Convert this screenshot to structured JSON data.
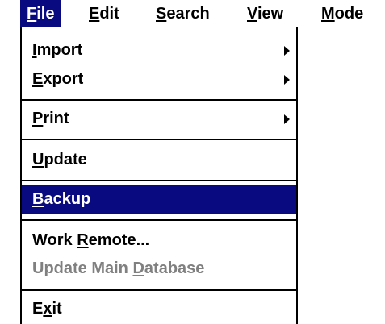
{
  "menubar": {
    "items": [
      {
        "pre": "",
        "acc": "F",
        "post": "ile",
        "active": true
      },
      {
        "pre": "",
        "acc": "E",
        "post": "dit",
        "active": false
      },
      {
        "pre": "",
        "acc": "S",
        "post": "earch",
        "active": false
      },
      {
        "pre": "",
        "acc": "V",
        "post": "iew",
        "active": false
      },
      {
        "pre": "",
        "acc": "M",
        "post": "ode",
        "active": false
      }
    ]
  },
  "file_menu": {
    "items": [
      {
        "pre": "",
        "acc": "I",
        "post": "mport",
        "submenu": true
      },
      {
        "pre": "",
        "acc": "E",
        "post": "xport",
        "submenu": true
      },
      {
        "pre": "",
        "acc": "P",
        "post": "rint",
        "submenu": true
      },
      {
        "pre": "",
        "acc": "U",
        "post": "pdate",
        "submenu": false
      },
      {
        "pre": "",
        "acc": "B",
        "post": "ackup",
        "submenu": false,
        "highlighted": true
      },
      {
        "pre": "Work ",
        "acc": "R",
        "post": "emote...",
        "submenu": false
      },
      {
        "pre": "Update Main ",
        "acc": "D",
        "post": "atabase",
        "submenu": false,
        "disabled": true
      },
      {
        "pre": "E",
        "acc": "x",
        "post": "it",
        "submenu": false
      }
    ]
  },
  "colors": {
    "highlight": "#0a0a80",
    "highlight_text": "#ffffff",
    "disabled_text": "#808080"
  },
  "icons": {
    "submenu_arrow": "chevron-right-icon"
  }
}
